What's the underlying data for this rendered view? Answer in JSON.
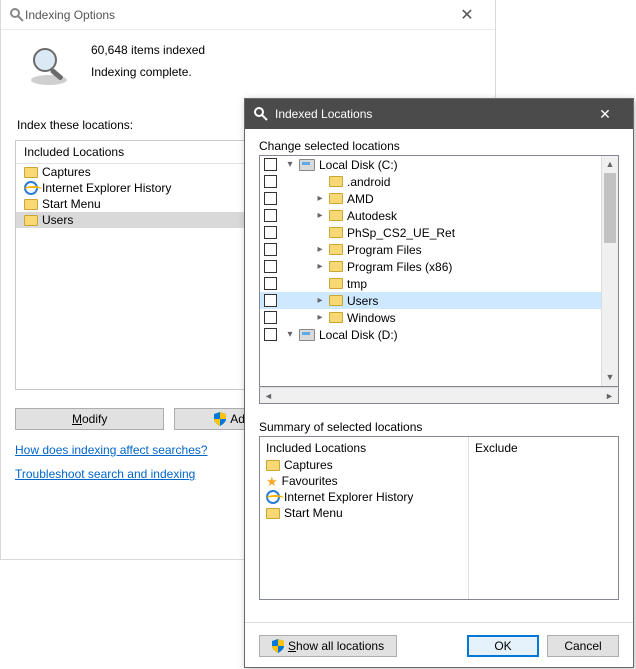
{
  "options": {
    "title": "Indexing Options",
    "items_line": "60,648 items indexed",
    "status_line": "Indexing complete.",
    "section_label": "Index these locations:",
    "included_header": "Included Locations",
    "rows": [
      {
        "icon": "folder",
        "label": "Captures"
      },
      {
        "icon": "ie",
        "label": "Internet Explorer History"
      },
      {
        "icon": "folder",
        "label": "Start Menu"
      },
      {
        "icon": "folder",
        "label": "Users",
        "selected": true
      }
    ],
    "modify_btn": "Modify",
    "advanced_btn": "Advanced",
    "link1": "How does indexing affect searches?",
    "link2": "Troubleshoot search and indexing"
  },
  "locations": {
    "title": "Indexed Locations",
    "change_label": "Change selected locations",
    "tree": [
      {
        "depth": 0,
        "expander": "down",
        "icon": "disk",
        "label": "Local Disk (C:)"
      },
      {
        "depth": 1,
        "expander": "",
        "icon": "folder",
        "label": ".android"
      },
      {
        "depth": 1,
        "expander": "right",
        "icon": "folder",
        "label": "AMD"
      },
      {
        "depth": 1,
        "expander": "right",
        "icon": "folder",
        "label": "Autodesk"
      },
      {
        "depth": 1,
        "expander": "",
        "icon": "folder",
        "label": "PhSp_CS2_UE_Ret"
      },
      {
        "depth": 1,
        "expander": "right",
        "icon": "folder",
        "label": "Program Files"
      },
      {
        "depth": 1,
        "expander": "right",
        "icon": "folder",
        "label": "Program Files (x86)"
      },
      {
        "depth": 1,
        "expander": "",
        "icon": "folder",
        "label": "tmp"
      },
      {
        "depth": 1,
        "expander": "right",
        "icon": "folder",
        "label": "Users",
        "selected": true
      },
      {
        "depth": 1,
        "expander": "right",
        "icon": "folder",
        "label": "Windows"
      },
      {
        "depth": 0,
        "expander": "down",
        "icon": "disk",
        "label": "Local Disk (D:)"
      }
    ],
    "summary_label": "Summary of selected locations",
    "summary_included_hdr": "Included Locations",
    "summary_exclude_hdr": "Exclude",
    "summary_rows": [
      {
        "icon": "folder",
        "label": "Captures"
      },
      {
        "icon": "star",
        "label": "Favourites"
      },
      {
        "icon": "ie",
        "label": "Internet Explorer History"
      },
      {
        "icon": "folder",
        "label": "Start Menu"
      }
    ],
    "show_all_btn": "Show all locations",
    "ok_btn": "OK",
    "cancel_btn": "Cancel"
  }
}
